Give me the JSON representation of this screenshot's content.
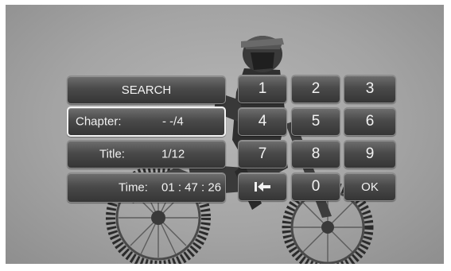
{
  "panel": {
    "search_label": "SEARCH",
    "chapter_label": "Chapter:",
    "chapter_value": "- -/4",
    "title_label": "Title:",
    "title_value": "1/12",
    "time_label": "Time:",
    "time_value": "01 : 47 : 26"
  },
  "keypad": {
    "keys": [
      "1",
      "2",
      "3",
      "4",
      "5",
      "6",
      "7",
      "8",
      "9",
      "",
      "0",
      "OK"
    ],
    "backspace_icon": "backspace-arrow-icon"
  },
  "colors": {
    "button_top": "#6f6f6f",
    "button_bottom": "#353535",
    "text": "#f2f2f2",
    "background": "#a4a4a4"
  }
}
